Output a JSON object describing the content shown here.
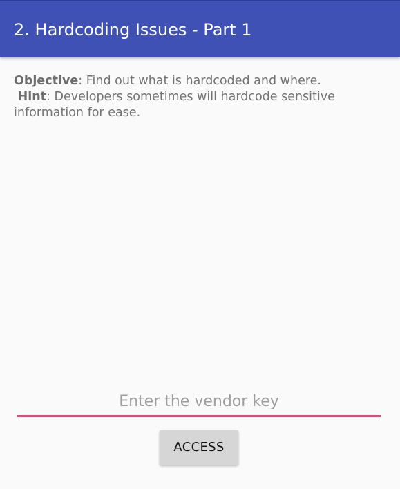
{
  "app_bar": {
    "title": "2. Hardcoding Issues - Part 1",
    "color": "#3f51b5"
  },
  "instructions": {
    "objective_label": "Objective",
    "objective_text": ": Find out what is hardcoded and where.",
    "hint_label": "Hint",
    "hint_text_line1": ": Developers sometimes will hardcode sensitive",
    "hint_text_line2": "information for ease."
  },
  "vendor_key": {
    "value": "",
    "placeholder": "Enter the vendor key",
    "underline_color": "#e64a7b"
  },
  "access_button": {
    "label": "ACCESS"
  }
}
